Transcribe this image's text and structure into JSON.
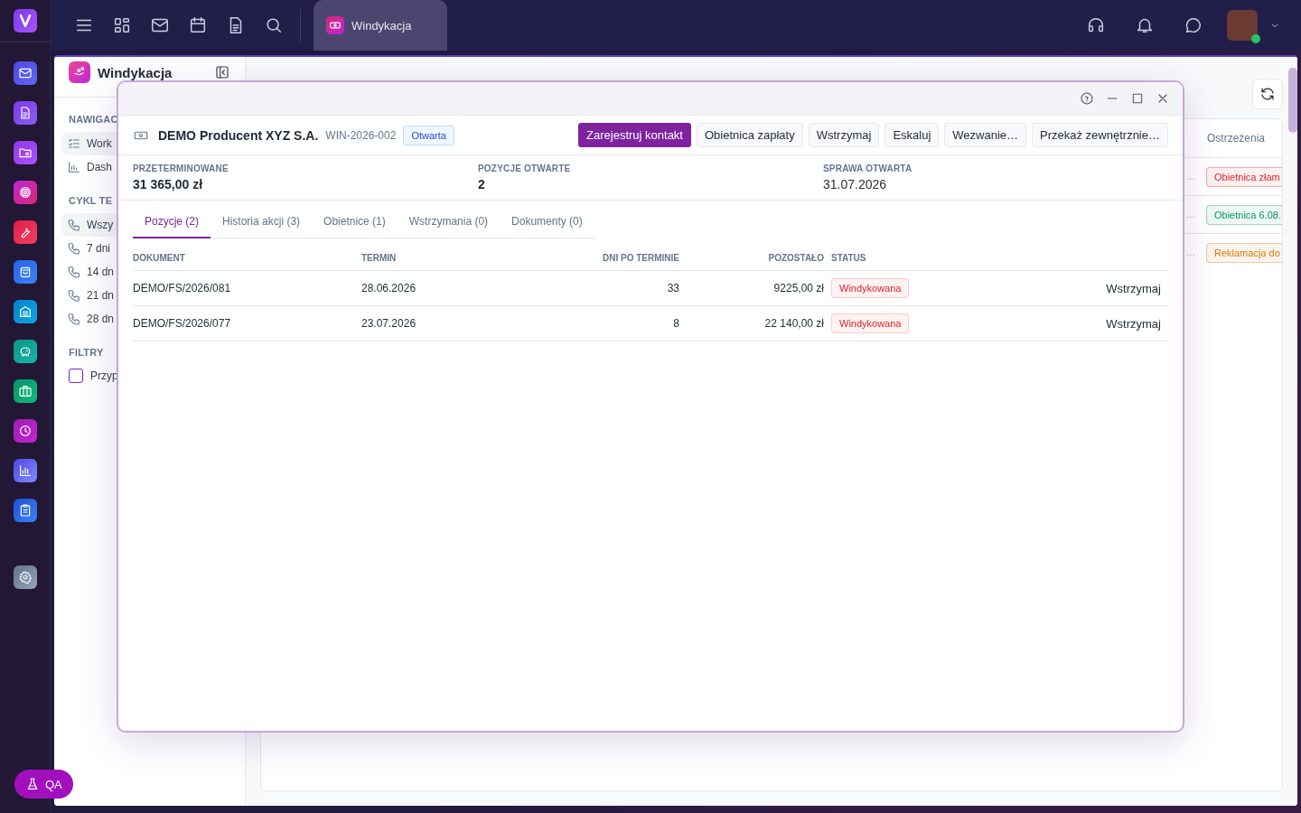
{
  "topbar": {
    "tabs": [
      {
        "label": "Windykacja",
        "selected": true
      }
    ]
  },
  "qa_button": {
    "label": "QA"
  },
  "sidebar": {
    "title": "Windykacja",
    "sections": [
      {
        "heading": "NAWIGAC",
        "items": [
          {
            "label": "Work",
            "selected": true
          },
          {
            "label": "Dash",
            "selected": false
          }
        ]
      },
      {
        "heading": "CYKL TE",
        "items": [
          {
            "label": "Wszy",
            "selected": true
          },
          {
            "label": "7 dni",
            "selected": false
          },
          {
            "label": "14 dn",
            "selected": false
          },
          {
            "label": "21 dn",
            "selected": false
          },
          {
            "label": "28 dn",
            "selected": false
          }
        ]
      },
      {
        "heading": "FILTRY",
        "filters": [
          {
            "label": "Przyp",
            "checked": false
          }
        ]
      }
    ]
  },
  "background_table": {
    "header": "Ostrzeżenia",
    "rows": [
      {
        "column_1": "…",
        "warning": "Obietnica złam",
        "color": "#dc2626"
      },
      {
        "column_1": "…",
        "warning": "Obietnica 6.08.",
        "color": "#059669"
      },
      {
        "column_1": "…",
        "warning": "Reklamacja do",
        "color": "#d97706"
      }
    ]
  },
  "dialog": {
    "client": "DEMO Producent XYZ S.A.",
    "case_number": "WIN-2026-002",
    "status": "Otwarta",
    "actions": [
      {
        "label": "Zarejestruj kontakt",
        "kind": "primary"
      },
      {
        "label": "Obietnica zapłaty",
        "kind": "secondary"
      },
      {
        "label": "Wstrzymaj",
        "kind": "secondary"
      },
      {
        "label": "Eskaluj",
        "kind": "secondary"
      },
      {
        "label": "Wezwanie…",
        "kind": "secondary"
      },
      {
        "label": "Przekaż zewnętrznie…",
        "kind": "secondary"
      }
    ],
    "stats": [
      {
        "label": "PRZETERMINOWANE",
        "value": "31 365,00 zł",
        "emphasis": true
      },
      {
        "label": "POZYCJE OTWARTE",
        "value": "2",
        "emphasis": true
      },
      {
        "label": "SPRAWA OTWARTA",
        "value": "31.07.2026",
        "emphasis": false
      }
    ],
    "tabs": [
      {
        "label": "Pozycje (2)",
        "selected": true
      },
      {
        "label": "Historia akcji (3)",
        "selected": false
      },
      {
        "label": "Obietnice (1)",
        "selected": false
      },
      {
        "label": "Wstrzymania (0)",
        "selected": false
      },
      {
        "label": "Dokumenty (0)",
        "selected": false
      }
    ],
    "table": {
      "columns": [
        "DOKUMENT",
        "TERMIN",
        "DNI PO TERMINIE",
        "POZOSTAŁO",
        "STATUS"
      ],
      "rows": [
        {
          "document": "DEMO/FS/2026/081",
          "due": "28.06.2026",
          "days_overdue": "33",
          "remaining": "9225,00 zł",
          "status": "Windykowana",
          "action": "Wstrzymaj"
        },
        {
          "document": "DEMO/FS/2026/077",
          "due": "23.07.2026",
          "days_overdue": "8",
          "remaining": "22 140,00 zł",
          "status": "Windykowana",
          "action": "Wstrzymaj"
        }
      ]
    }
  }
}
